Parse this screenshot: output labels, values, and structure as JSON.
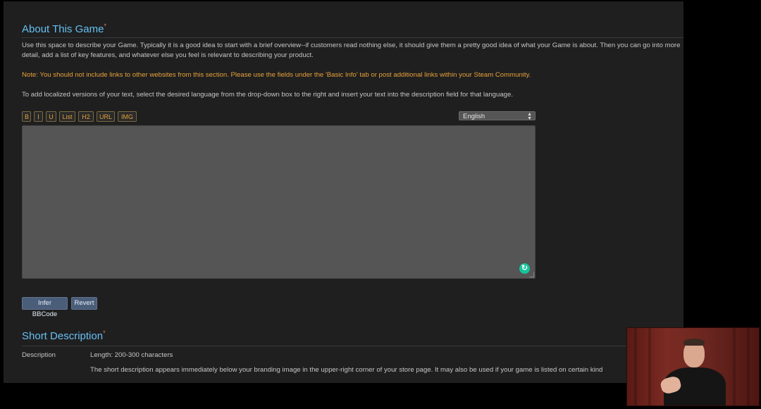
{
  "about": {
    "title": "About This Game",
    "required_mark": "*",
    "description": "Use this space to describe your Game. Typically it is a good idea to start with a brief overview--if customers read nothing else, it should give them a pretty good idea of what your Game is about. Then you can go into more detail, add a list of key features, and whatever else you feel is relevant to describing your product.",
    "note": "Note: You should not include links to other websites from this section. Please use the fields under the 'Basic Info' tab or post additional links within your Steam Community.",
    "localization_help": "To add localized versions of your text, select the desired language from the drop-down box to the right and insert your text into the description field for that language."
  },
  "toolbar": {
    "bold": "B",
    "italic": "I",
    "underline": "U",
    "list": "List",
    "h2": "H2",
    "url": "URL",
    "img": "IMG"
  },
  "language_select": {
    "value": "English",
    "arrows_icon": "up-down-arrows-icon"
  },
  "editor": {
    "value": "",
    "grammar_icon": "grammarly-icon"
  },
  "actions": {
    "infer_bbcode": "Infer BBCode",
    "revert": "Revert"
  },
  "short_description": {
    "title": "Short Description",
    "required_mark": "*",
    "label": "Description",
    "length_hint": "Length: 200-300 characters",
    "help": "The short description appears immediately below your branding image in the upper-right corner of your store page. It may also be used if your game is listed on certain kind"
  },
  "colors": {
    "title_blue": "#66c0f4",
    "note_orange": "#e8a13a",
    "button_blue": "#4a5e7a",
    "background": "#1f1f1f"
  }
}
